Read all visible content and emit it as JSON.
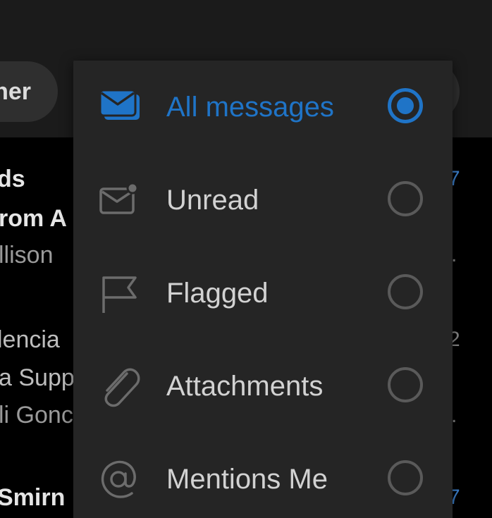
{
  "colors": {
    "accent": "#1f74c7",
    "menu_bg": "#252525",
    "topbar_bg": "#1b1b1b",
    "text": "#d2d2d2",
    "radio_off": "#5a5a5a"
  },
  "toolbar": {
    "filter_chip_label": "ner"
  },
  "email_list": {
    "rows": [
      {
        "sender": "ds",
        "subject": "rom A",
        "preview": "llison",
        "date": "7",
        "trail": "."
      },
      {
        "sender": "lencia",
        "subject": "a Supp",
        "preview": "li Gonc",
        "date": "2",
        "trail": "."
      },
      {
        "sender": "Smirn",
        "date": "7"
      }
    ]
  },
  "filter_menu": {
    "items": [
      {
        "label": "All messages",
        "icon": "envelope-stack-icon",
        "selected": true
      },
      {
        "label": "Unread",
        "icon": "unread-envelope-icon",
        "selected": false
      },
      {
        "label": "Flagged",
        "icon": "flag-icon",
        "selected": false
      },
      {
        "label": "Attachments",
        "icon": "paperclip-icon",
        "selected": false
      },
      {
        "label": "Mentions Me",
        "icon": "at-sign-icon",
        "selected": false
      }
    ]
  }
}
